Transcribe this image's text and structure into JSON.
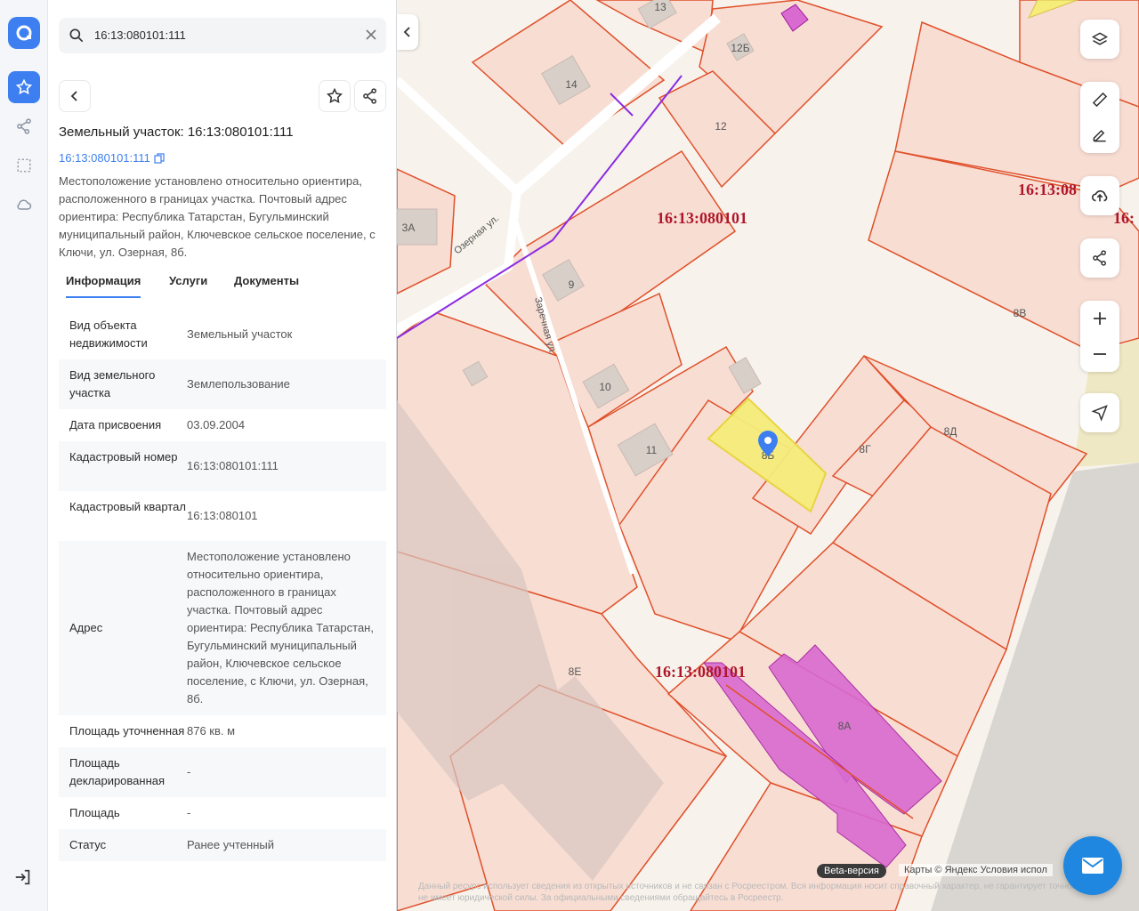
{
  "search": {
    "query": "16:13:080101:111"
  },
  "header": {
    "title": "Земельный участок: 16:13:080101:111",
    "cadastral_link": "16:13:080101:111",
    "description": "Местоположение установлено относительно ориентира, расположенного в границах участка. Почтовый адрес ориентира: Республика Татарстан, Бугульминский муниципальный район, Ключевское сельское поселение, с Ключи, ул. Озерная, 8б."
  },
  "tabs": [
    "Информация",
    "Услуги",
    "Документы"
  ],
  "info_rows": [
    {
      "label": "Вид объекта недвижимости",
      "value": "Земельный участок"
    },
    {
      "label": "Вид земельного участка",
      "value": "Землепользование"
    },
    {
      "label": "Дата присвоения",
      "value": "03.09.2004"
    },
    {
      "label": "Кадастровый номер",
      "value": "16:13:080101:111"
    },
    {
      "label": "Кадастровый квартал",
      "value": "16:13:080101"
    },
    {
      "label": "Адрес",
      "value": "Местоположение установлено относительно ориентира, расположенного в границах участка. Почтовый адрес ориентира: Республика Татарстан, Бугульминский муниципальный район, Ключевское сельское поселение, с Ключи, ул. Озерная, 8б."
    },
    {
      "label": "Площадь уточненная",
      "value": "876 кв. м"
    },
    {
      "label": "Площадь декларированная",
      "value": "-"
    },
    {
      "label": "Площадь",
      "value": "-"
    },
    {
      "label": "Статус",
      "value": "Ранее учтенный"
    }
  ],
  "map": {
    "quarter_label": "16:13:080101",
    "quarter_label_2": "16:13:080101",
    "quarter_label_right": "16:13:08",
    "quarter_label_right_2": "16:",
    "parcel_labels": [
      "13",
      "14",
      "12Б",
      "12",
      "3А",
      "9",
      "10",
      "11",
      "8Б",
      "8Г",
      "8Д",
      "8В",
      "8Е",
      "8А"
    ],
    "streets": [
      "Озерная ул.",
      "Заречная ул."
    ],
    "beta": "Beta-версия",
    "attribution": "Карты © Яндекс   Условия испол",
    "disclaimer": "Данный ресурс использует сведения из открытых источников и не связан с Росреестром. Вся информация носит справочный характер, не гарантирует точность и не имеет юридической силы. За официальными сведениями обращайтесь в Росреестр."
  },
  "colors": {
    "accent": "#3d7ff0",
    "parcel_border": "#e0502a",
    "selected": "#f5ec7a",
    "building_pink": "#d86ad0"
  }
}
